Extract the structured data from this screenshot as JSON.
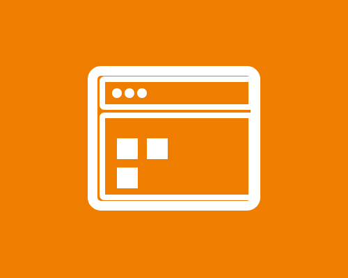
{
  "colors": {
    "background": "#EE7D00",
    "foreground": "#FFFFFF"
  },
  "icon": {
    "name": "browser-window-icon",
    "title_bar_dots": 3,
    "content_tiles": 3
  }
}
